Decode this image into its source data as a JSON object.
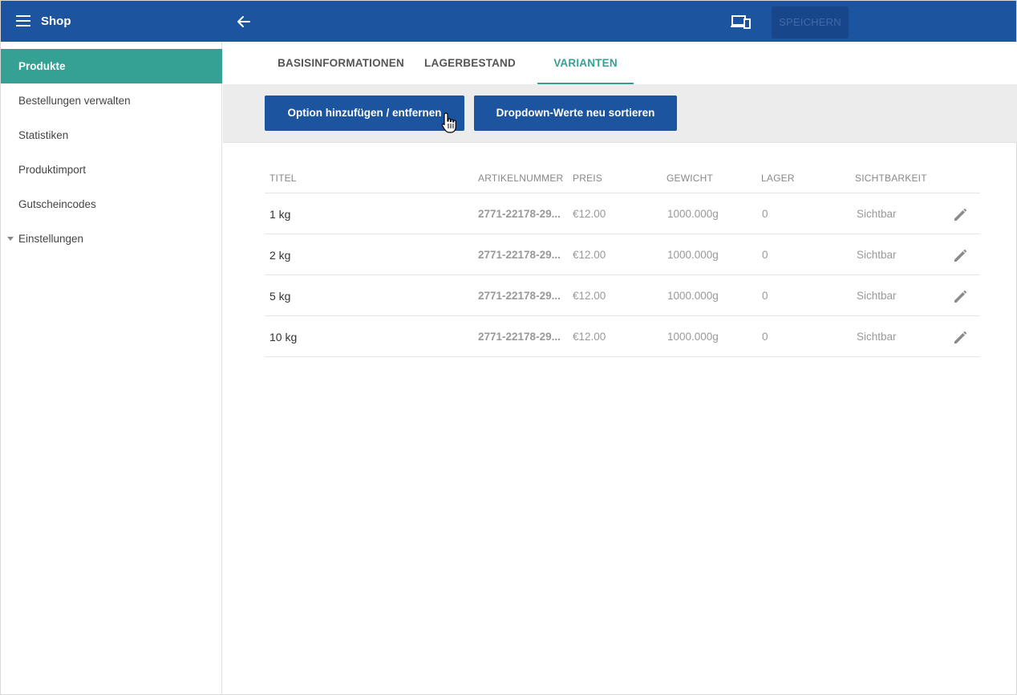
{
  "header": {
    "app_title": "Shop",
    "menu_icon": "hamburger-icon",
    "back_icon": "arrow-left-icon",
    "device_icon": "devices-icon",
    "save_label": "SPEICHERN"
  },
  "sidebar": {
    "items": [
      {
        "label": "Produkte",
        "active": true
      },
      {
        "label": "Bestellungen verwalten"
      },
      {
        "label": "Statistiken"
      },
      {
        "label": "Produktimport"
      },
      {
        "label": "Gutscheincodes"
      },
      {
        "label": "Einstellungen",
        "expandable": true
      }
    ]
  },
  "tabs": [
    {
      "label": "BASISINFORMATIONEN"
    },
    {
      "label": "LAGERBESTAND"
    },
    {
      "label": "VARIANTEN",
      "active": true
    }
  ],
  "actions": {
    "add_remove_option": "Option hinzufügen / entfernen",
    "resort_dropdown": "Dropdown-Werte neu sortieren"
  },
  "table": {
    "columns": [
      "TITEL",
      "ARTIKELNUMMER",
      "PREIS",
      "GEWICHT",
      "LAGER",
      "SICHTBARKEIT"
    ],
    "rows": [
      {
        "title": "1 kg",
        "sku": "2771-22178-29...",
        "price": "€12.00",
        "weight": "1000.000g",
        "stock": "0",
        "visibility": "Sichtbar"
      },
      {
        "title": "2 kg",
        "sku": "2771-22178-29...",
        "price": "€12.00",
        "weight": "1000.000g",
        "stock": "0",
        "visibility": "Sichtbar"
      },
      {
        "title": "5 kg",
        "sku": "2771-22178-29...",
        "price": "€12.00",
        "weight": "1000.000g",
        "stock": "0",
        "visibility": "Sichtbar"
      },
      {
        "title": "10 kg",
        "sku": "2771-22178-29...",
        "price": "€12.00",
        "weight": "1000.000g",
        "stock": "0",
        "visibility": "Sichtbar"
      }
    ]
  },
  "colors": {
    "primary": "#1c54a0",
    "accent": "#35a195"
  }
}
